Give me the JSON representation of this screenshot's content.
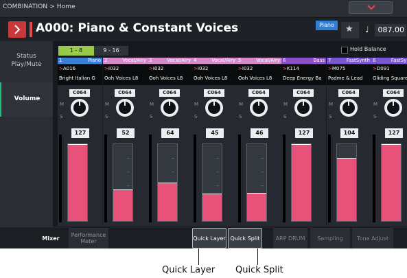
{
  "header": {
    "breadcrumb": "COMBINATION > Home",
    "program_title": "A000: Piano & Constant Voices",
    "category_badge": "Piano",
    "tempo_symbol": "♩",
    "tempo": "087.00"
  },
  "sidebar": {
    "items": [
      {
        "label_line1": "Status",
        "label_line2": "Play/Mute"
      },
      {
        "label": "Volume",
        "selected": true
      }
    ]
  },
  "timbre_range": {
    "tabs": [
      "1 - 8",
      "9 - 16"
    ],
    "selected": "1 - 8"
  },
  "hold_balance": {
    "label": "Hold Balance",
    "checked": false
  },
  "channels": [
    {
      "num": "1",
      "category": "Piano",
      "color": "#3b7fd8",
      "program": "A016",
      "name": "Bright Italian G",
      "ctrl": "C064",
      "volume": "127"
    },
    {
      "num": "2",
      "category": "Vocal/Airy",
      "color": "#d489c9",
      "program": "I032",
      "name": "Ooh Voices L8",
      "ctrl": "C064",
      "volume": "52"
    },
    {
      "num": "3",
      "category": "Vocal/Airy",
      "color": "#d489c9",
      "program": "I032",
      "name": "Ooh Voices L8",
      "ctrl": "C064",
      "volume": "64"
    },
    {
      "num": "4",
      "category": "Vocal/Airy",
      "color": "#d489c9",
      "program": "I032",
      "name": "Ooh Voices L8",
      "ctrl": "C064",
      "volume": "45"
    },
    {
      "num": "5",
      "category": "Vocal/Airy",
      "color": "#d489c9",
      "program": "I032",
      "name": "Ooh Voices L8",
      "ctrl": "C064",
      "volume": "46"
    },
    {
      "num": "6",
      "category": "Bass",
      "color": "#8a4fc4",
      "program": "K114",
      "name": "Deep Energy Ba",
      "ctrl": "C064",
      "volume": "127"
    },
    {
      "num": "7",
      "category": "FastSynth",
      "color": "#7a55cf",
      "program": "M075",
      "name": "Padme & Lead",
      "ctrl": "C064",
      "volume": "104"
    },
    {
      "num": "8",
      "category": "FastSynth",
      "color": "#7a55cf",
      "program": "D091",
      "name": "Gliding Square",
      "ctrl": "C064",
      "volume": "127"
    }
  ],
  "knob_labels": {
    "m": "M",
    "s": "S"
  },
  "bottom_tabs": [
    {
      "label": "Mixer"
    },
    {
      "label": "Performance Meter"
    },
    {
      "label": "Quick Layer"
    },
    {
      "label": "Quick Split"
    },
    {
      "label": "ARP DRUM"
    },
    {
      "label": "Sampling"
    },
    {
      "label": "Tone Adjust"
    }
  ],
  "callouts": {
    "quick_layer": "Quick Layer",
    "quick_split": "Quick Split"
  },
  "colors": {
    "accent_green": "#9ac94a",
    "fader_pink": "#e8527a",
    "title_red": "#c8373a"
  }
}
